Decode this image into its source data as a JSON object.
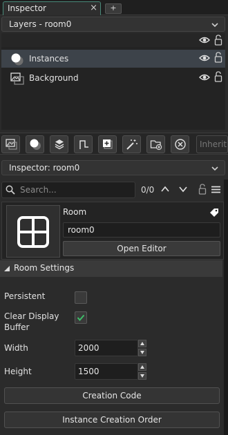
{
  "tabs": {
    "active_label": "Inspector",
    "close_glyph": "×",
    "add_glyph": "+"
  },
  "layers_dropdown": {
    "label": "Layers - room0"
  },
  "layers": [
    {
      "label": "Instances",
      "icon": "instances-layer-icon",
      "selected": true
    },
    {
      "label": "Background",
      "icon": "background-layer-icon",
      "selected": false
    }
  ],
  "toolbar": {
    "buttons": [
      "add-background-layer-icon",
      "add-instance-layer-icon",
      "add-tile-layer-icon",
      "add-path-layer-icon",
      "add-asset-layer-icon",
      "add-effect-layer-icon",
      "add-folder-icon",
      "delete-layer-icon"
    ],
    "inherit_placeholder": "Inherit Layer"
  },
  "inspector_dropdown": {
    "label": "Inspector: room0"
  },
  "search": {
    "placeholder": "Search...",
    "count": "0/0"
  },
  "object": {
    "type": "Room",
    "name": "room0",
    "open_editor_label": "Open Editor"
  },
  "room_settings": {
    "title": "Room Settings",
    "persistent_label": "Persistent",
    "persistent_checked": false,
    "clear_display_label_line1": "Clear Display",
    "clear_display_label_line2": "Buffer",
    "clear_display_checked": true,
    "width_label": "Width",
    "width_value": "2000",
    "height_label": "Height",
    "height_value": "1500",
    "creation_code_label": "Creation Code",
    "instance_order_label": "Instance Creation Order"
  },
  "colors": {
    "accent_check": "#3ec06a",
    "selected_row": "#3d434a",
    "background": "#2b2b2b"
  }
}
